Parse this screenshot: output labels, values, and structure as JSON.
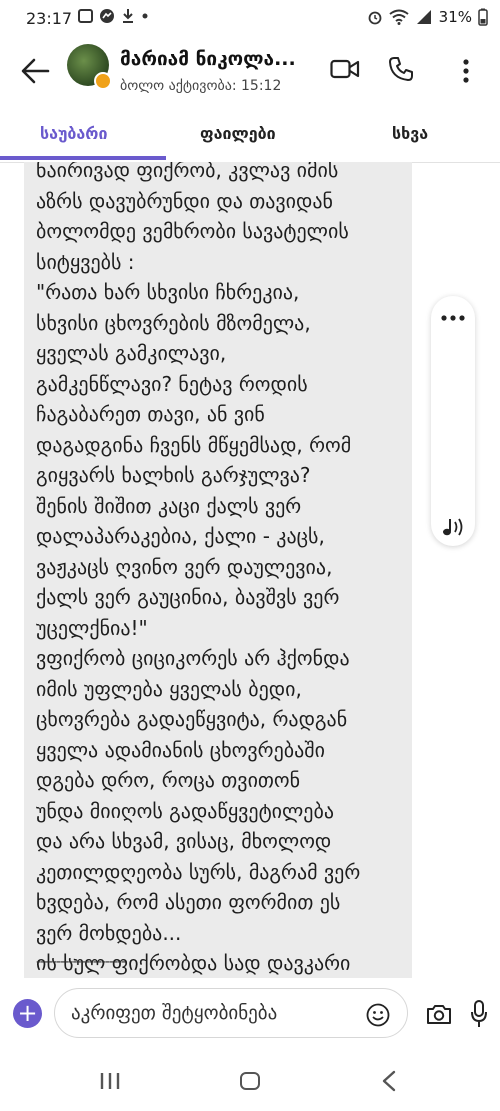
{
  "status_bar": {
    "time": "23:17",
    "battery": "31%",
    "icons": [
      "photo-icon",
      "messenger-icon",
      "download-icon",
      "dot-icon",
      "alarm-icon",
      "wifi-icon",
      "signal-icon",
      "battery-icon"
    ]
  },
  "header": {
    "contact_name": "მარიამ ნიკოლა...",
    "last_active": "ბოლო აქტივობა: 15:12"
  },
  "tabs": [
    {
      "label": "საუბარი",
      "active": true
    },
    {
      "label": "ფაილები",
      "active": false
    },
    {
      "label": "სხვა",
      "active": false
    }
  ],
  "message": {
    "text": "ნაირივად ფიქრობ, კვლავ იმის\nაზრს დავუბრუნდი და თავიდან\nბოლომდე ვემხრობი სავატელის\nსიტყვებს :\n\"რათა ხარ სხვისი ჩხრეკია,\nსხვისი ცხოვრების მზომელა,\nყველას გამკილავი,\nგამკენწლავი? ნეტავ როდის\nჩაგაბარეთ თავი, ან ვინ\nდაგადგინა ჩვენს მწყემსად, რომ\nგიყვარს ხალხის გარჯულვა?\nშენის შიშით კაცი ქალს ვერ\nდალაპარაკებია, ქალი - კაცს,\nვაჟკაცს ღვინო ვერ დაულევია,\nქალს ვერ გაუცინია, ბავშვს ვერ\nუცელქნია!\"\nვფიქრობ ციციკორეს არ ჰქონდა\nიმის უფლება ყველას ბედი,\nცხოვრება გადაეწყვიტა, რადგან\nყველა ადამიანის ცხოვრებაში\nდგება დრო, როცა თვითონ\nუნდა მიიღოს გადაწყვეტილება\nდა არა სხვამ, ვისაც, მხოლოდ\nკეთილდღეობა სურს, მაგრამ ვერ\nხვდება, რომ ასეთი ფორმით ეს\nვერ მოხდება...\nის სულ ფიქრობდა სად დავკარი\nდა სად გავარდაო!..",
    "divider": "----------------------"
  },
  "composer": {
    "placeholder": "აკრიფეთ შეტყობინება"
  },
  "colors": {
    "accent": "#6a5acd",
    "bubble": "#ebebeb"
  }
}
